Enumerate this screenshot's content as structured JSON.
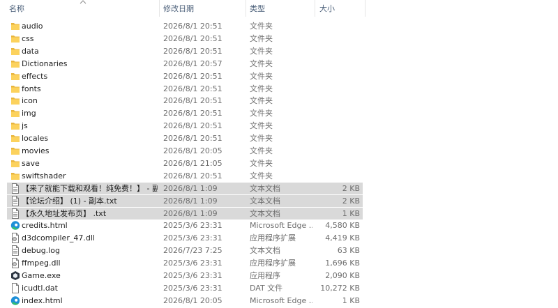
{
  "columns": {
    "name": "名称",
    "date": "修改日期",
    "type": "类型",
    "size": "大小"
  },
  "files": [
    {
      "name": "audio",
      "date": "2026/8/1 20:51",
      "type": "文件夹",
      "size": "",
      "icon": "folder-icon"
    },
    {
      "name": "css",
      "date": "2026/8/1 20:51",
      "type": "文件夹",
      "size": "",
      "icon": "folder-icon"
    },
    {
      "name": "data",
      "date": "2026/8/1 20:51",
      "type": "文件夹",
      "size": "",
      "icon": "folder-icon"
    },
    {
      "name": "Dictionaries",
      "date": "2026/8/1 20:57",
      "type": "文件夹",
      "size": "",
      "icon": "folder-icon"
    },
    {
      "name": "effects",
      "date": "2026/8/1 20:51",
      "type": "文件夹",
      "size": "",
      "icon": "folder-icon"
    },
    {
      "name": "fonts",
      "date": "2026/8/1 20:51",
      "type": "文件夹",
      "size": "",
      "icon": "folder-icon"
    },
    {
      "name": "icon",
      "date": "2026/8/1 20:51",
      "type": "文件夹",
      "size": "",
      "icon": "folder-icon"
    },
    {
      "name": "img",
      "date": "2026/8/1 20:51",
      "type": "文件夹",
      "size": "",
      "icon": "folder-icon"
    },
    {
      "name": "js",
      "date": "2026/8/1 20:51",
      "type": "文件夹",
      "size": "",
      "icon": "folder-icon"
    },
    {
      "name": "locales",
      "date": "2026/8/1 20:51",
      "type": "文件夹",
      "size": "",
      "icon": "folder-icon"
    },
    {
      "name": "movies",
      "date": "2026/8/1 20:05",
      "type": "文件夹",
      "size": "",
      "icon": "folder-icon"
    },
    {
      "name": "save",
      "date": "2026/8/1 21:05",
      "type": "文件夹",
      "size": "",
      "icon": "folder-icon"
    },
    {
      "name": "swiftshader",
      "date": "2026/8/1 20:51",
      "type": "文件夹",
      "size": "",
      "icon": "folder-icon"
    },
    {
      "name": "【来了就能下载和观看！纯免费！】 - 副...",
      "date": "2026/8/1 1:09",
      "type": "文本文档",
      "size": "2 KB",
      "icon": "text-file-icon",
      "selected": true
    },
    {
      "name": "【论坛介绍】 (1) - 副本.txt",
      "date": "2026/8/1 1:09",
      "type": "文本文档",
      "size": "2 KB",
      "icon": "text-file-icon",
      "selected": true
    },
    {
      "name": "【永久地址发布页】 .txt",
      "date": "2026/8/1 1:09",
      "type": "文本文档",
      "size": "1 KB",
      "icon": "text-file-icon",
      "selected": true
    },
    {
      "name": "credits.html",
      "date": "2025/3/6 23:31",
      "type": "Microsoft Edge ...",
      "size": "4,580 KB",
      "icon": "edge-icon"
    },
    {
      "name": "d3dcompiler_47.dll",
      "date": "2025/3/6 23:31",
      "type": "应用程序扩展",
      "size": "4,419 KB",
      "icon": "dll-file-icon"
    },
    {
      "name": "debug.log",
      "date": "2026/7/23 7:25",
      "type": "文本文档",
      "size": "63 KB",
      "icon": "text-file-icon"
    },
    {
      "name": "ffmpeg.dll",
      "date": "2025/3/6 23:31",
      "type": "应用程序扩展",
      "size": "1,696 KB",
      "icon": "dll-file-icon"
    },
    {
      "name": "Game.exe",
      "date": "2025/3/6 23:31",
      "type": "应用程序",
      "size": "2,090 KB",
      "icon": "game-exe-icon"
    },
    {
      "name": "icudtl.dat",
      "date": "2025/3/6 23:31",
      "type": "DAT 文件",
      "size": "10,272 KB",
      "icon": "blank-file-icon"
    },
    {
      "name": "index.html",
      "date": "2026/8/1 20:05",
      "type": "Microsoft Edge ...",
      "size": "1 KB",
      "icon": "edge-icon"
    }
  ]
}
